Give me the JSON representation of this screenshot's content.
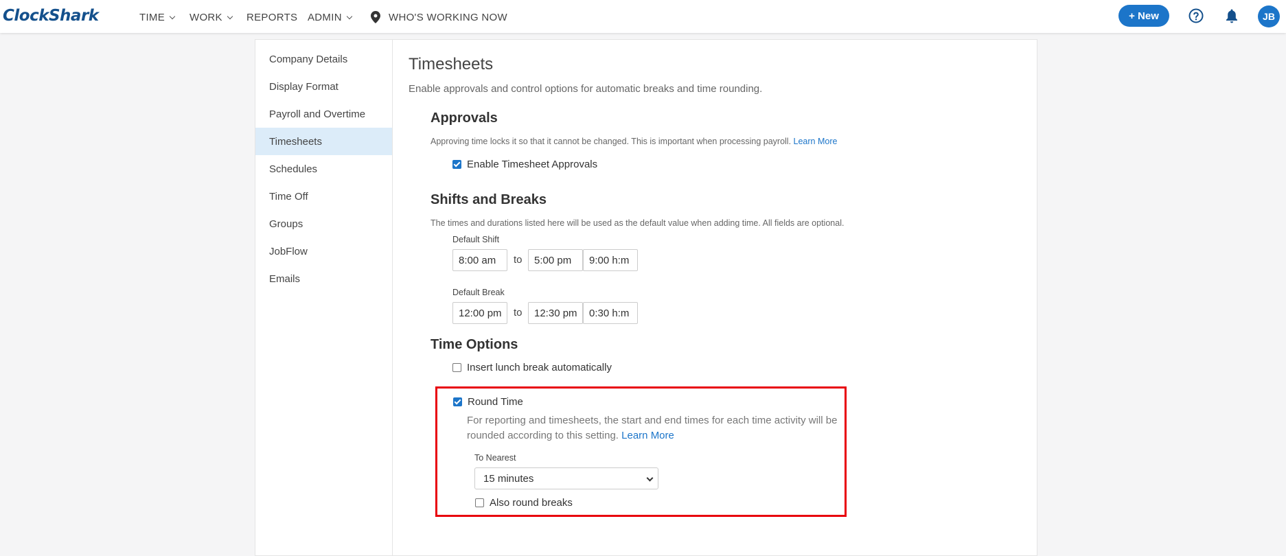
{
  "brand": {
    "logo_text": "ClockShark",
    "accent": "#1c75c9"
  },
  "nav": {
    "time": "TIME",
    "work": "WORK",
    "reports": "REPORTS",
    "admin": "ADMIN",
    "whos_working": "WHO'S WORKING NOW",
    "new_button": "+ New",
    "avatar_initials": "JB"
  },
  "sidebar": {
    "items": [
      {
        "label": "Company Details"
      },
      {
        "label": "Display Format"
      },
      {
        "label": "Payroll and Overtime"
      },
      {
        "label": "Timesheets"
      },
      {
        "label": "Schedules"
      },
      {
        "label": "Time Off"
      },
      {
        "label": "Groups"
      },
      {
        "label": "JobFlow"
      },
      {
        "label": "Emails"
      }
    ],
    "active_index": 3
  },
  "page": {
    "title": "Timesheets",
    "subtitle": "Enable approvals and control options for automatic breaks and time rounding."
  },
  "approvals": {
    "title": "Approvals",
    "desc": "Approving time locks it so that it cannot be changed. This is important when processing payroll.",
    "learn_more": "Learn More",
    "enable_label": "Enable Timesheet Approvals",
    "enable_checked": true
  },
  "shifts": {
    "title": "Shifts and Breaks",
    "desc": "The times and durations listed here will be used as the default value when adding time. All fields are optional.",
    "default_shift_label": "Default Shift",
    "shift_start": "8:00 am",
    "shift_end": "5:00 pm",
    "shift_duration": "9:00 h:m",
    "default_break_label": "Default Break",
    "break_start": "12:00 pm",
    "break_end": "12:30 pm",
    "break_duration": "0:30 h:m",
    "to": "to"
  },
  "time_options": {
    "title": "Time Options",
    "insert_lunch_label": "Insert lunch break automatically",
    "insert_lunch_checked": false,
    "round_time_label": "Round Time",
    "round_time_checked": true,
    "round_desc": "For reporting and timesheets, the start and end times for each time activity will be rounded according to this setting.",
    "learn_more": "Learn More",
    "to_nearest_label": "To Nearest",
    "to_nearest_value": "15 minutes",
    "also_round_label": "Also round breaks",
    "also_round_checked": false,
    "highlight_color": "#e8000b"
  }
}
